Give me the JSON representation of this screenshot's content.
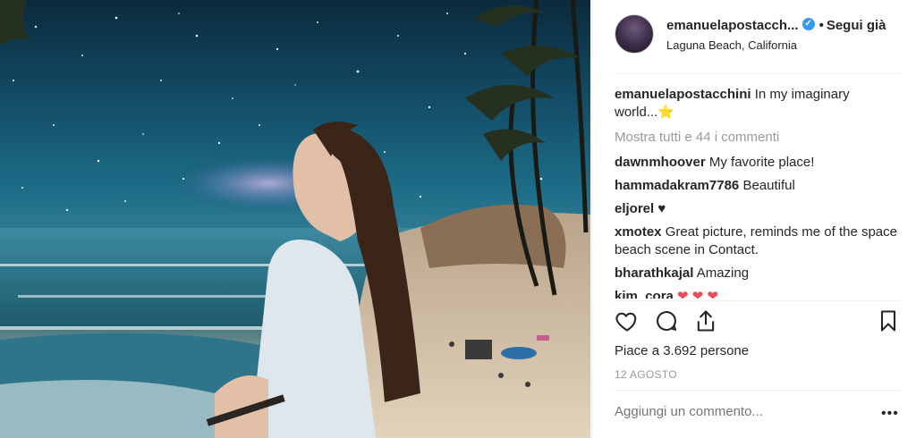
{
  "post": {
    "username": "emanuelapostacch...",
    "follow_separator": "•",
    "follow_label": "Segui già",
    "location": "Laguna Beach, California"
  },
  "caption": {
    "user": "emanuelapostacchini",
    "text": "In my imaginary world...⭐"
  },
  "show_all_comments": "Mostra tutti e 44 i commenti",
  "comments": [
    {
      "user": "dawnmhoover",
      "text": "My favorite place!"
    },
    {
      "user": "hammadakram7786",
      "text": "Beautiful"
    },
    {
      "user": "eljorel",
      "text": "♥"
    },
    {
      "user": "xmotex",
      "text": "Great picture, reminds me of the space beach scene in Contact."
    },
    {
      "user": "bharathkajal",
      "text": "Amazing"
    },
    {
      "user": "kim_cora",
      "text": "❤ ❤ ❤"
    }
  ],
  "likes": "Piace a 3.692 persone",
  "date": "12 AGOSTO",
  "add_comment_placeholder": "Aggiungi un commento...",
  "more_options": "•••",
  "icons": {
    "like": "heart-icon",
    "comment": "comment-icon",
    "share": "share-icon",
    "save": "bookmark-icon",
    "verified": "verified-badge-icon"
  },
  "colors": {
    "verified": "#3897f0",
    "muted_text": "#999999",
    "text": "#262626"
  }
}
